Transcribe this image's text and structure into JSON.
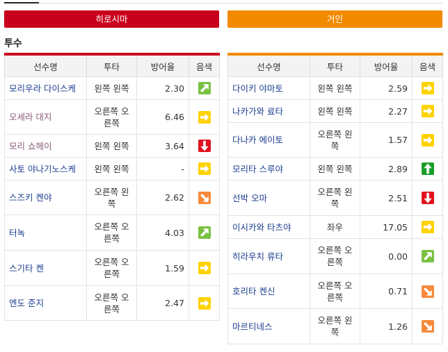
{
  "teams": {
    "left": "히로시마",
    "right": "거인"
  },
  "section_title": "투수",
  "headers": {
    "name": "선수명",
    "throw": "투타",
    "era": "방어율",
    "cond": "음색"
  },
  "left_rows": [
    {
      "name": "모리우라 다이스케",
      "throw": "왼쪽 왼쪽",
      "era": "2.30",
      "cond": "up-right"
    },
    {
      "name": "오세라 대지",
      "throw": "오른쪽 오른쪽",
      "era": "6.46",
      "cond": "right"
    },
    {
      "name": "모리 쇼헤이",
      "throw": "왼쪽 왼쪽",
      "era": "3.64",
      "cond": "down"
    },
    {
      "name": "사토 야나기노스케",
      "throw": "왼쪽 왼쪽",
      "era": "-",
      "cond": "right"
    },
    {
      "name": "스즈키 켄야",
      "throw": "오른쪽 왼쪽",
      "era": "2.62",
      "cond": "down-right"
    },
    {
      "name": "터녹",
      "throw": "오른쪽 오른쪽",
      "era": "4.03",
      "cond": "up-right"
    },
    {
      "name": "스기타 켄",
      "throw": "오른쪽 오른쪽",
      "era": "1.59",
      "cond": "right"
    },
    {
      "name": "엔도 준지",
      "throw": "오른쪽 오른쪽",
      "era": "2.47",
      "cond": "right"
    }
  ],
  "right_rows": [
    {
      "name": "다이키 야마토",
      "throw": "왼쪽 왼쪽",
      "era": "2.59",
      "cond": "right"
    },
    {
      "name": "나카가와 료타",
      "throw": "왼쪽 왼쪽",
      "era": "2.27",
      "cond": "right"
    },
    {
      "name": "다나카 에이토",
      "throw": "오른쪽 왼쪽",
      "era": "1.57",
      "cond": "right"
    },
    {
      "name": "모리타 스루야",
      "throw": "왼쪽 왼쪽",
      "era": "2.89",
      "cond": "up"
    },
    {
      "name": "선박 오마",
      "throw": "오른쪽 왼쪽",
      "era": "2.51",
      "cond": "down"
    },
    {
      "name": "이시카와 타츠야",
      "throw": "좌우",
      "era": "17.05",
      "cond": "right"
    },
    {
      "name": "히라우치 류타",
      "throw": "오른쪽 오른쪽",
      "era": "0.00",
      "cond": "up-right"
    },
    {
      "name": "호리타 켄신",
      "throw": "오른쪽 오른쪽",
      "era": "0.71",
      "cond": "down-right"
    },
    {
      "name": "마르티네스",
      "throw": "오른쪽 왼쪽",
      "era": "1.26",
      "cond": "down-right"
    }
  ],
  "condition_colors": {
    "up": "#1a9e2a",
    "up-right": "#7ac143",
    "right": "#ffd200",
    "down-right": "#f7893b",
    "down": "#e0141e"
  }
}
